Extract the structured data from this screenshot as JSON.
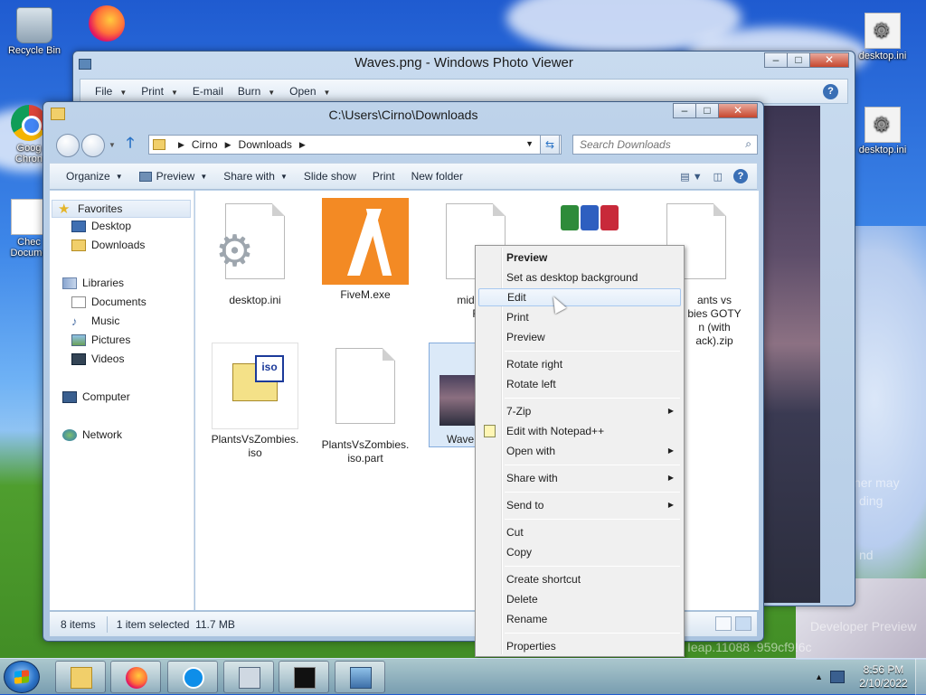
{
  "desktop": {
    "icons": [
      {
        "label": "Recycle Bin",
        "icon": "recycle-bin-icon"
      },
      {
        "label": "Google Chrome",
        "icon": "chrome-icon"
      },
      {
        "label": "Check Documents",
        "icon": "document-icon"
      },
      {
        "label": "desktop.ini",
        "icon": "settings-file-icon"
      },
      {
        "label": "desktop.ini",
        "icon": "settings-file-icon"
      },
      {
        "label": "",
        "icon": "firefox-icon"
      }
    ],
    "visible_labels": {
      "recycle": "Recycle Bin",
      "chrome": "Goog\nChron",
      "check": "Chec\nDocume",
      "ini1": "desktop.ini",
      "ini2": "desktop.ini"
    },
    "watermark": {
      "line1": "ner may",
      "line2": "ding",
      "line3": "nd",
      "developer": "Developer Preview",
      "build": "Ieap.11088 .959cf9!",
      "build_suffix": "6c"
    }
  },
  "photo_viewer": {
    "title": "Waves.png - Windows Photo Viewer",
    "menu": [
      "File",
      "Print",
      "E-mail",
      "Burn",
      "Open"
    ],
    "menu_has_dropdown": [
      true,
      true,
      false,
      true,
      true
    ]
  },
  "explorer": {
    "title": "C:\\Users\\Cirno\\Downloads",
    "breadcrumb": [
      "Cirno",
      "Downloads"
    ],
    "search_placeholder": "Search Downloads",
    "toolbar": [
      {
        "label": "Organize",
        "dropdown": true
      },
      {
        "label": "Preview",
        "dropdown": true
      },
      {
        "label": "Share with",
        "dropdown": true
      },
      {
        "label": "Slide show",
        "dropdown": false
      },
      {
        "label": "Print",
        "dropdown": false
      },
      {
        "label": "New folder",
        "dropdown": false
      }
    ],
    "nav": {
      "favorites": "Favorites",
      "desktop": "Desktop",
      "downloads": "Downloads",
      "libraries": "Libraries",
      "documents": "Documents",
      "music": "Music",
      "pictures": "Pictures",
      "videos": "Videos",
      "computer": "Computer",
      "network": "Network"
    },
    "files": {
      "desktop_ini": "desktop.ini",
      "fivem": "FiveM.exe",
      "midi": "midi-col",
      "midi_2": "F",
      "pvz_goty": "ants vs\nbies GOTY\nn (with\nack).zip",
      "pvz_iso": "PlantsVsZombies.\niso",
      "pvz_part": "PlantsVsZombies.\niso.part",
      "waves": "Wave"
    },
    "status": {
      "count": "8 items",
      "selection": "1 item selected  11.7 MB"
    }
  },
  "context_menu": {
    "items": [
      {
        "label": "Preview",
        "bold": true
      },
      {
        "label": "Set as desktop background"
      },
      {
        "label": "Edit",
        "highlighted": true
      },
      {
        "label": "Print"
      },
      {
        "label": "Preview"
      },
      {
        "separator": true
      },
      {
        "label": "Rotate right"
      },
      {
        "label": "Rotate left"
      },
      {
        "separator": true
      },
      {
        "label": "7-Zip",
        "submenu": true
      },
      {
        "label": "Edit with Notepad++",
        "icon": "notepad-plus-plus-icon"
      },
      {
        "label": "Open with",
        "submenu": true
      },
      {
        "separator": true
      },
      {
        "label": "Share with",
        "submenu": true
      },
      {
        "separator": true
      },
      {
        "label": "Send to",
        "submenu": true
      },
      {
        "separator": true
      },
      {
        "label": "Cut"
      },
      {
        "label": "Copy"
      },
      {
        "separator": true
      },
      {
        "label": "Create shortcut"
      },
      {
        "label": "Delete"
      },
      {
        "label": "Rename"
      },
      {
        "separator": true
      },
      {
        "label": "Properties"
      }
    ]
  },
  "taskbar": {
    "pinned": [
      "explorer-icon",
      "firefox-icon",
      "teamviewer-icon",
      "task-manager-icon",
      "command-prompt-icon",
      "photo-viewer-icon"
    ],
    "time": "8:56 PM",
    "date": "2/10/2022"
  }
}
